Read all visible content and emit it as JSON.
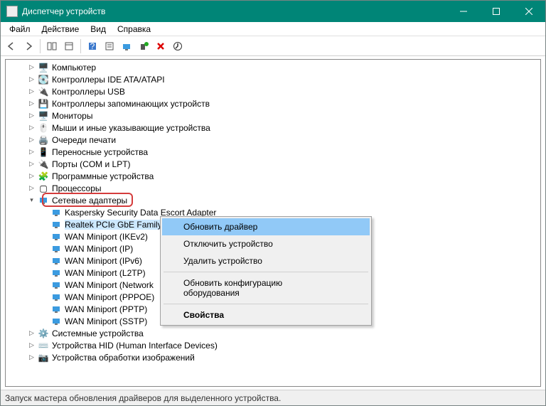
{
  "window": {
    "title": "Диспетчер устройств"
  },
  "menu": {
    "file": "Файл",
    "action": "Действие",
    "view": "Вид",
    "help": "Справка"
  },
  "tree": {
    "n0": "Компьютер",
    "n1": "Контроллеры IDE ATA/ATAPI",
    "n2": "Контроллеры USB",
    "n3": "Контроллеры запоминающих устройств",
    "n4": "Мониторы",
    "n5": "Мыши и иные указывающие устройства",
    "n6": "Очереди печати",
    "n7": "Переносные устройства",
    "n8": "Порты (COM и LPT)",
    "n9": "Программные устройства",
    "n10": "Процессоры",
    "n11": "Сетевые адаптеры",
    "n11_0": "Kaspersky Security Data Escort Adapter",
    "n11_1": "Realtek PCIe GbE Family C",
    "n11_2": "WAN Miniport (IKEv2)",
    "n11_3": "WAN Miniport (IP)",
    "n11_4": "WAN Miniport (IPv6)",
    "n11_5": "WAN Miniport (L2TP)",
    "n11_6": "WAN Miniport (Network",
    "n11_7": "WAN Miniport (PPPOE)",
    "n11_8": "WAN Miniport (PPTP)",
    "n11_9": "WAN Miniport (SSTP)",
    "n12": "Системные устройства",
    "n13": "Устройства HID (Human Interface Devices)",
    "n14": "Устройства обработки изображений"
  },
  "context": {
    "update": "Обновить драйвер",
    "disable": "Отключить устройство",
    "uninstall": "Удалить устройство",
    "scan": "Обновить конфигурацию оборудования",
    "props": "Свойства"
  },
  "status": "Запуск мастера обновления драйверов для выделенного устройства."
}
